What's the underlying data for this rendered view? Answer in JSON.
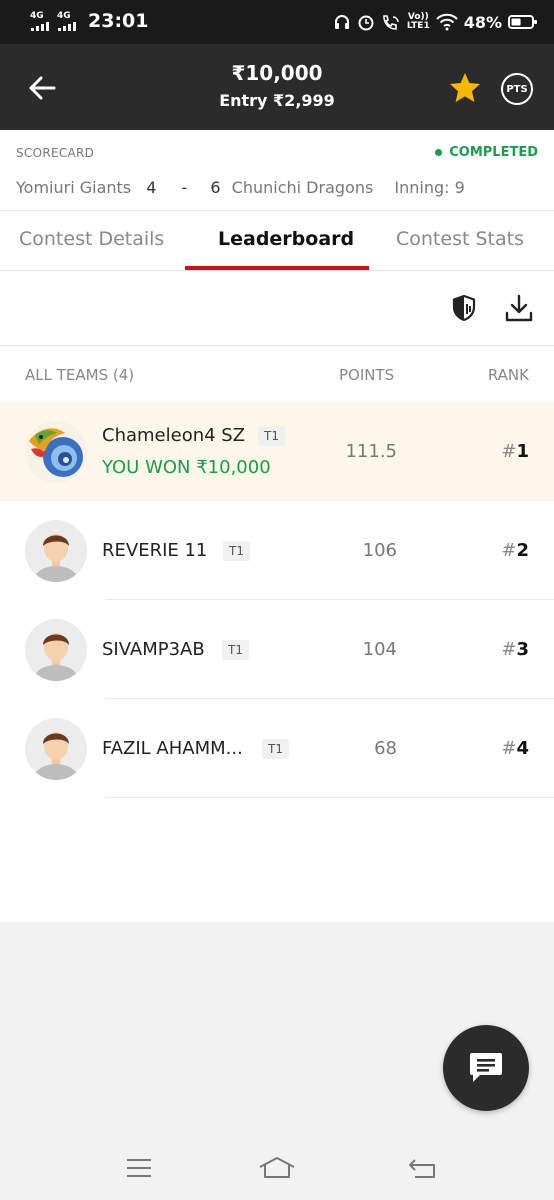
{
  "status_bar": {
    "network1": "4G",
    "network2": "4G",
    "time": "23:01",
    "volte_top": "Vo))",
    "volte_bottom": "LTE1",
    "battery_pct": "48%",
    "battery_level": 0.48
  },
  "header": {
    "prize": "₹10,000",
    "entry": "Entry ₹2,999",
    "pts_label": "PTS",
    "star_color": "#f5b800"
  },
  "scorecard": {
    "label": "SCORECARD",
    "status": "COMPLETED",
    "status_color": "#1a9e4b",
    "team1": "Yomiuri Giants",
    "score1": "4",
    "separator": "-",
    "score2": "6",
    "team2": "Chunichi Dragons",
    "inning": "Inning: 9"
  },
  "tabs": [
    {
      "label": "Contest Details",
      "active": false
    },
    {
      "label": "Leaderboard",
      "active": true
    },
    {
      "label": "Contest Stats",
      "active": false
    }
  ],
  "accent_color": "#d0101b",
  "list_header": {
    "all_teams": "ALL TEAMS (4)",
    "points": "POINTS",
    "rank": "RANK"
  },
  "rows": [
    {
      "name": "Chameleon4 SZ",
      "badge": "T1",
      "won": "YOU WON ₹10,000",
      "points": "111.5",
      "rank_hash": "#",
      "rank": "1"
    },
    {
      "name": "REVERIE 11",
      "badge": "T1",
      "points": "106",
      "rank_hash": "#",
      "rank": "2"
    },
    {
      "name": "SIVAMP3AB",
      "badge": "T1",
      "points": "104",
      "rank_hash": "#",
      "rank": "3"
    },
    {
      "name": "FAZIL AHAMM...",
      "badge": "T1",
      "points": "68",
      "rank_hash": "#",
      "rank": "4"
    }
  ],
  "icons": {
    "back": "arrow-left-icon",
    "star": "star-icon",
    "compare": "shield-icon",
    "download": "download-icon",
    "chat": "chat-icon",
    "nav_menu": "menu-icon",
    "nav_home": "home-icon",
    "nav_back": "back-icon"
  }
}
